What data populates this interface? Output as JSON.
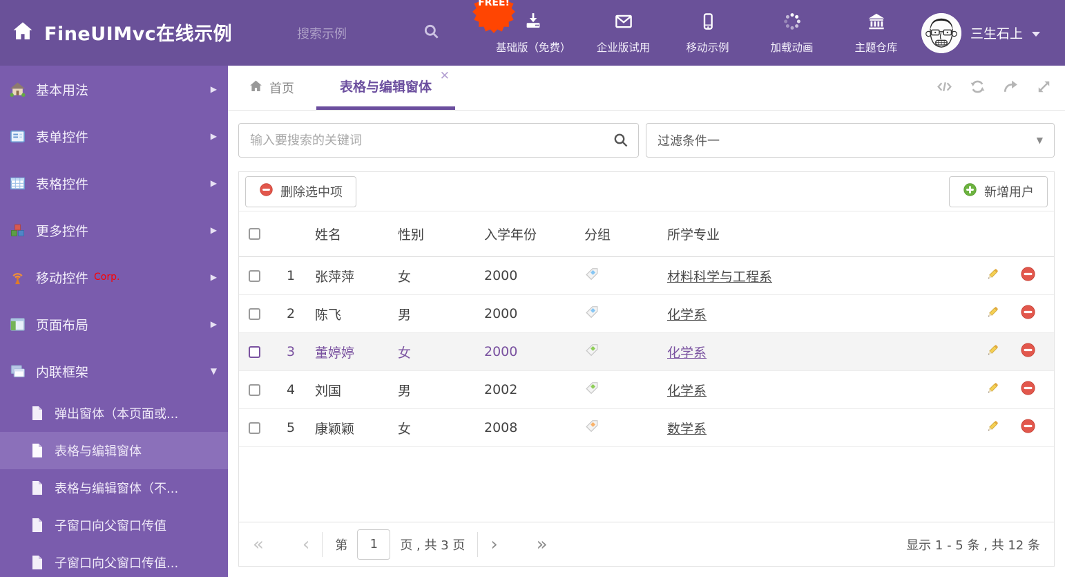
{
  "header": {
    "app_title": "FineUIMvc在线示例",
    "search_placeholder": "搜索示例",
    "free_badge": "FREE!",
    "nav_items": [
      {
        "icon": "download-icon",
        "label": "基础版（免费）"
      },
      {
        "icon": "envelope-icon",
        "label": "企业版试用"
      },
      {
        "icon": "phone-icon",
        "label": "移动示例"
      },
      {
        "icon": "spinner-icon",
        "label": "加载动画"
      },
      {
        "icon": "bank-icon",
        "label": "主题仓库"
      }
    ],
    "user_name": "三生石上"
  },
  "sidebar": {
    "items": [
      {
        "label": "基本用法",
        "icon": "home",
        "arrow": "right"
      },
      {
        "label": "表单控件",
        "icon": "form",
        "arrow": "right"
      },
      {
        "label": "表格控件",
        "icon": "grid",
        "arrow": "right"
      },
      {
        "label": "更多控件",
        "icon": "cubes",
        "arrow": "right"
      },
      {
        "label": "移动控件",
        "icon": "antenna",
        "arrow": "right",
        "corp": "Corp."
      },
      {
        "label": "页面布局",
        "icon": "layout",
        "arrow": "right"
      },
      {
        "label": "内联框架",
        "icon": "frames",
        "arrow": "down",
        "expanded": true
      }
    ],
    "subitems": [
      {
        "label": "弹出窗体（本页面或...",
        "selected": false
      },
      {
        "label": "表格与编辑窗体",
        "selected": true
      },
      {
        "label": "表格与编辑窗体（不...",
        "selected": false
      },
      {
        "label": "子窗口向父窗口传值",
        "selected": false
      },
      {
        "label": "子窗口向父窗口传值...",
        "selected": false
      }
    ]
  },
  "tabs": [
    {
      "label": "首页",
      "active": false,
      "closable": false
    },
    {
      "label": "表格与编辑窗体",
      "active": true,
      "closable": true
    }
  ],
  "filters": {
    "search_placeholder": "输入要搜索的关键词",
    "filter_selected": "过滤条件一"
  },
  "grid": {
    "delete_button": "删除选中项",
    "add_button": "新增用户",
    "columns": {
      "name": "姓名",
      "gender": "性别",
      "year": "入学年份",
      "group": "分组",
      "major": "所学专业"
    },
    "rows": [
      {
        "index": 1,
        "name": "张萍萍",
        "gender": "女",
        "year": "2000",
        "tag_color": "#86c6f4",
        "major": "材料科学与工程系",
        "selected": false
      },
      {
        "index": 2,
        "name": "陈飞",
        "gender": "男",
        "year": "2000",
        "tag_color": "#86c6f4",
        "major": "化学系",
        "selected": false
      },
      {
        "index": 3,
        "name": "董婷婷",
        "gender": "女",
        "year": "2000",
        "tag_color": "#8fce5a",
        "major": "化学系",
        "selected": true
      },
      {
        "index": 4,
        "name": "刘国",
        "gender": "男",
        "year": "2002",
        "tag_color": "#8fce5a",
        "major": "化学系",
        "selected": false
      },
      {
        "index": 5,
        "name": "康颖颖",
        "gender": "女",
        "year": "2008",
        "tag_color": "#f9b26a",
        "major": "数学系",
        "selected": false
      }
    ],
    "pager": {
      "prefix": "第",
      "page_value": "1",
      "suffix": "页 , 共 3 页",
      "summary": "显示 1 - 5 条 , 共 12 条"
    }
  },
  "colors": {
    "header_bg": "#6a5199",
    "sidebar_bg": "#7a5cad",
    "accent_purple": "#6b4e9e",
    "badge_orange": "#ff4502",
    "delete_red": "#e2574c",
    "add_green": "#6cb33f"
  }
}
